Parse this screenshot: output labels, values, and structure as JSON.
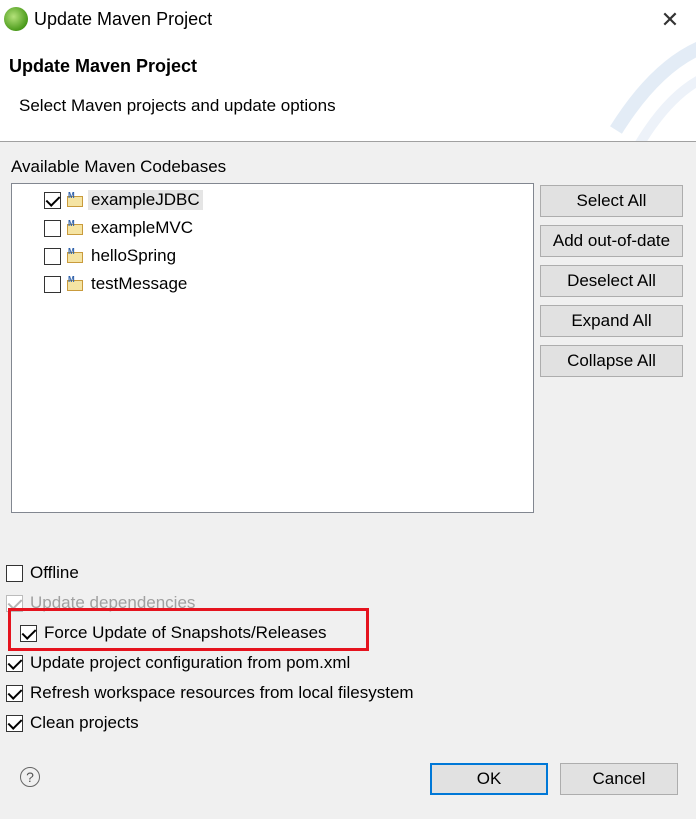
{
  "window": {
    "title": "Update Maven Project",
    "close_glyph": "✕"
  },
  "header": {
    "title": "Update Maven Project",
    "description": "Select Maven projects and update options"
  },
  "codebases": {
    "label": "Available Maven Codebases",
    "items": [
      {
        "name": "exampleJDBC",
        "checked": true,
        "selected": true
      },
      {
        "name": "exampleMVC",
        "checked": false,
        "selected": false
      },
      {
        "name": "helloSpring",
        "checked": false,
        "selected": false
      },
      {
        "name": "testMessage",
        "checked": false,
        "selected": false
      }
    ]
  },
  "buttons": {
    "select_all": "Select All",
    "add_out_of_date": "Add out-of-date",
    "deselect_all": "Deselect All",
    "expand_all": "Expand All",
    "collapse_all": "Collapse All"
  },
  "options": [
    {
      "label": "Offline",
      "checked": false,
      "enabled": true
    },
    {
      "label": "Update dependencies",
      "checked": true,
      "enabled": false
    },
    {
      "label": "Force Update of Snapshots/Releases",
      "checked": true,
      "enabled": true
    },
    {
      "label": "Update project configuration from pom.xml",
      "checked": true,
      "enabled": true
    },
    {
      "label": "Refresh workspace resources from local filesystem",
      "checked": true,
      "enabled": true
    },
    {
      "label": "Clean projects",
      "checked": true,
      "enabled": true
    }
  ],
  "footer": {
    "help_glyph": "?",
    "ok": "OK",
    "cancel": "Cancel"
  },
  "colors": {
    "highlight": "#e5131e",
    "default_button_border": "#0078d7"
  },
  "icons": {
    "app": "eclipse-icon",
    "project": "maven-project-icon",
    "help": "help-icon"
  }
}
